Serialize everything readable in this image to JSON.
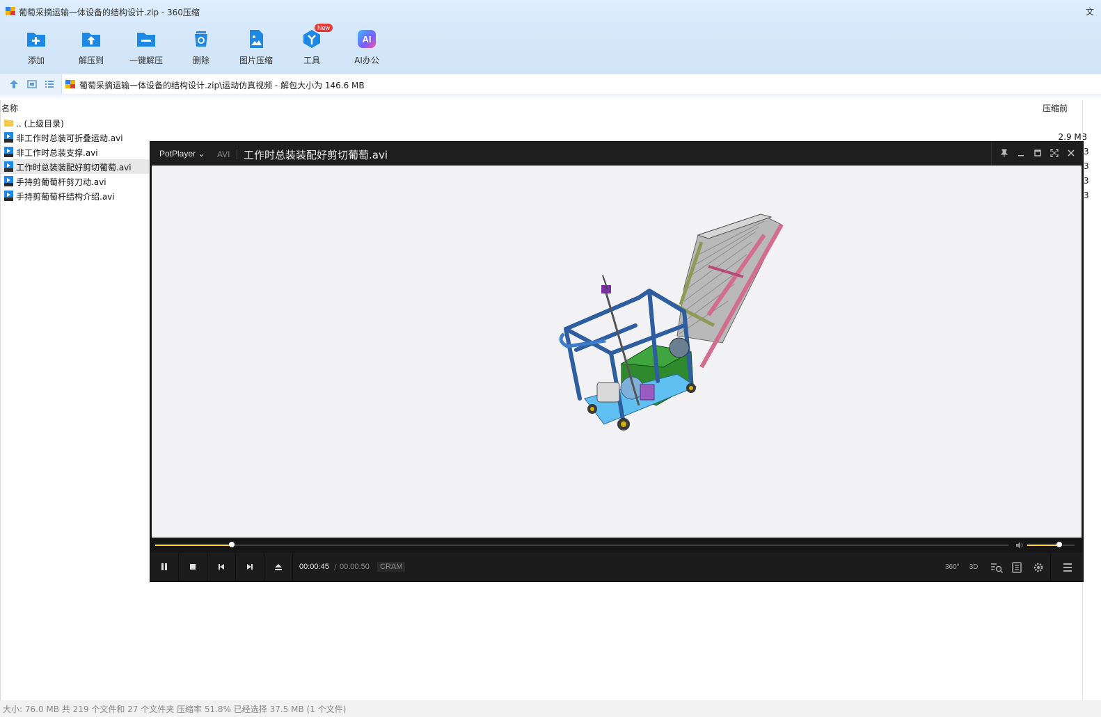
{
  "window": {
    "title": "葡萄采摘运输一体设备的结构设计.zip - 360压缩",
    "cut_char": "文"
  },
  "toolbar": {
    "items": [
      {
        "label": "添加",
        "icon": "add-folder-icon"
      },
      {
        "label": "解压到",
        "icon": "extract-to-icon"
      },
      {
        "label": "一键解压",
        "icon": "one-click-extract-icon"
      },
      {
        "label": "删除",
        "icon": "delete-icon"
      },
      {
        "label": "图片压缩",
        "icon": "image-compress-icon"
      },
      {
        "label": "工具",
        "icon": "tools-icon",
        "badge": "New"
      },
      {
        "label": "AI办公",
        "icon": "ai-office-icon",
        "icon_text": "AI"
      }
    ]
  },
  "address": {
    "path": "葡萄采摘运输一体设备的结构设计.zip\\运动仿真视频 - 解包大小为 146.6 MB"
  },
  "columns": {
    "name": "名称",
    "before_compress": "压缩前"
  },
  "files": [
    {
      "name": ".. (上级目录)",
      "type": "folder",
      "size": ""
    },
    {
      "name": "非工作时总装可折叠运动.avi",
      "type": "avi",
      "size": "2.9 MB"
    },
    {
      "name": "非工作时总装支撑.avi",
      "type": "avi",
      "size": "",
      "size_glyph": "3"
    },
    {
      "name": "工作时总装装配好剪切葡萄.avi",
      "type": "avi",
      "size": "",
      "size_glyph": "3",
      "selected": true
    },
    {
      "name": "手持剪葡萄杆剪刀动.avi",
      "type": "avi",
      "size": "",
      "size_glyph": "3"
    },
    {
      "name": "手持剪葡萄杆结构介绍.avi",
      "type": "avi",
      "size": "",
      "size_glyph": "3"
    }
  ],
  "status": {
    "text": "大小: 76.0 MB 共 219 个文件和 27 个文件夹 压缩率 51.8% 已经选择 37.5 MB (1 个文件)"
  },
  "player": {
    "brand": "PotPlayer",
    "format": "AVI",
    "file": "工作时总装装配好剪切葡萄.avi",
    "time_current": "00:00:45",
    "time_separator": "/",
    "time_total": "00:00:50",
    "codec": "CRAM",
    "progress": 0.09,
    "volume": 0.68,
    "right_controls": [
      "360°",
      "3D"
    ],
    "colors": {
      "accent": "#ffd83a",
      "background": "#1c1c1c"
    }
  }
}
